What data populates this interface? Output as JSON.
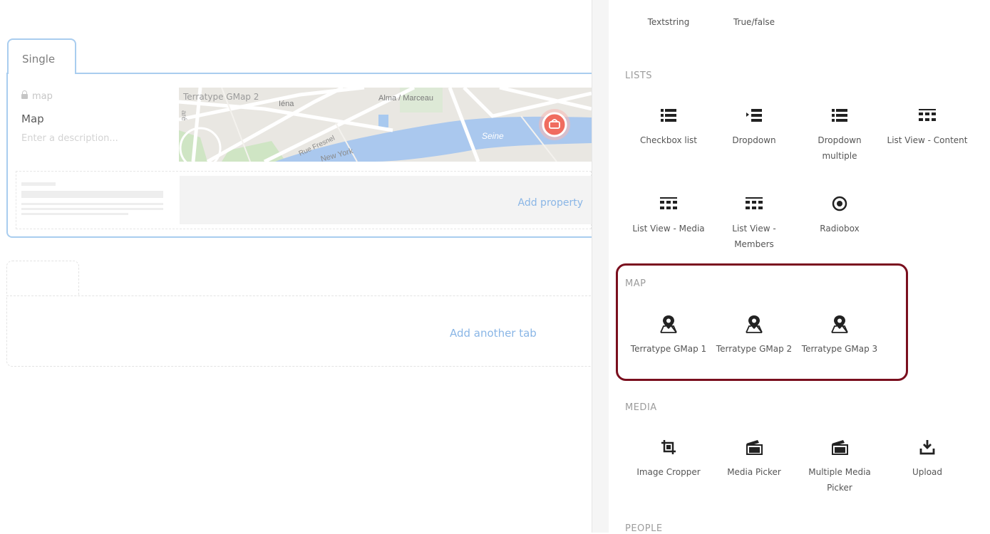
{
  "editor": {
    "tab_label": "Single",
    "property": {
      "alias": "map",
      "name": "Map",
      "description_placeholder": "Enter a description...",
      "editor_label": "Terratype GMap 2"
    },
    "map_labels": {
      "iena": "Iéna",
      "alma": "Alma / Marceau",
      "seine": "Seine",
      "fresnel": "Rue Fresnel",
      "new_york": "New York",
      "edge": "aré"
    },
    "add_property": "Add property",
    "add_tab": "Add another tab"
  },
  "panel": {
    "top_items": [
      "Textstring",
      "True/false"
    ],
    "sections": [
      {
        "title": "LISTS",
        "items": [
          {
            "label": "Checkbox list",
            "icon": "list-bullets-icon"
          },
          {
            "label": "Dropdown",
            "icon": "dropdown-list-icon"
          },
          {
            "label": "Dropdown multiple",
            "icon": "list-bullets-icon"
          },
          {
            "label": "List View - Content",
            "icon": "list-view-grid-icon"
          },
          {
            "label": "List View - Media",
            "icon": "list-view-grid-icon"
          },
          {
            "label": "List View - Members",
            "icon": "list-view-grid-icon"
          },
          {
            "label": "Radiobox",
            "icon": "radio-target-icon"
          }
        ]
      },
      {
        "title": "MAP",
        "items": [
          {
            "label": "Terratype GMap 1",
            "icon": "map-pin-icon"
          },
          {
            "label": "Terratype GMap 2",
            "icon": "map-pin-icon"
          },
          {
            "label": "Terratype GMap 3",
            "icon": "map-pin-icon"
          }
        ]
      },
      {
        "title": "MEDIA",
        "items": [
          {
            "label": "Image Cropper",
            "icon": "crop-icon"
          },
          {
            "label": "Media Picker",
            "icon": "media-picker-icon"
          },
          {
            "label": "Multiple Media Picker",
            "icon": "media-picker-icon"
          },
          {
            "label": "Upload",
            "icon": "upload-icon"
          }
        ]
      },
      {
        "title": "PEOPLE",
        "items": []
      }
    ],
    "highlight_color": "#7a0f1e"
  }
}
